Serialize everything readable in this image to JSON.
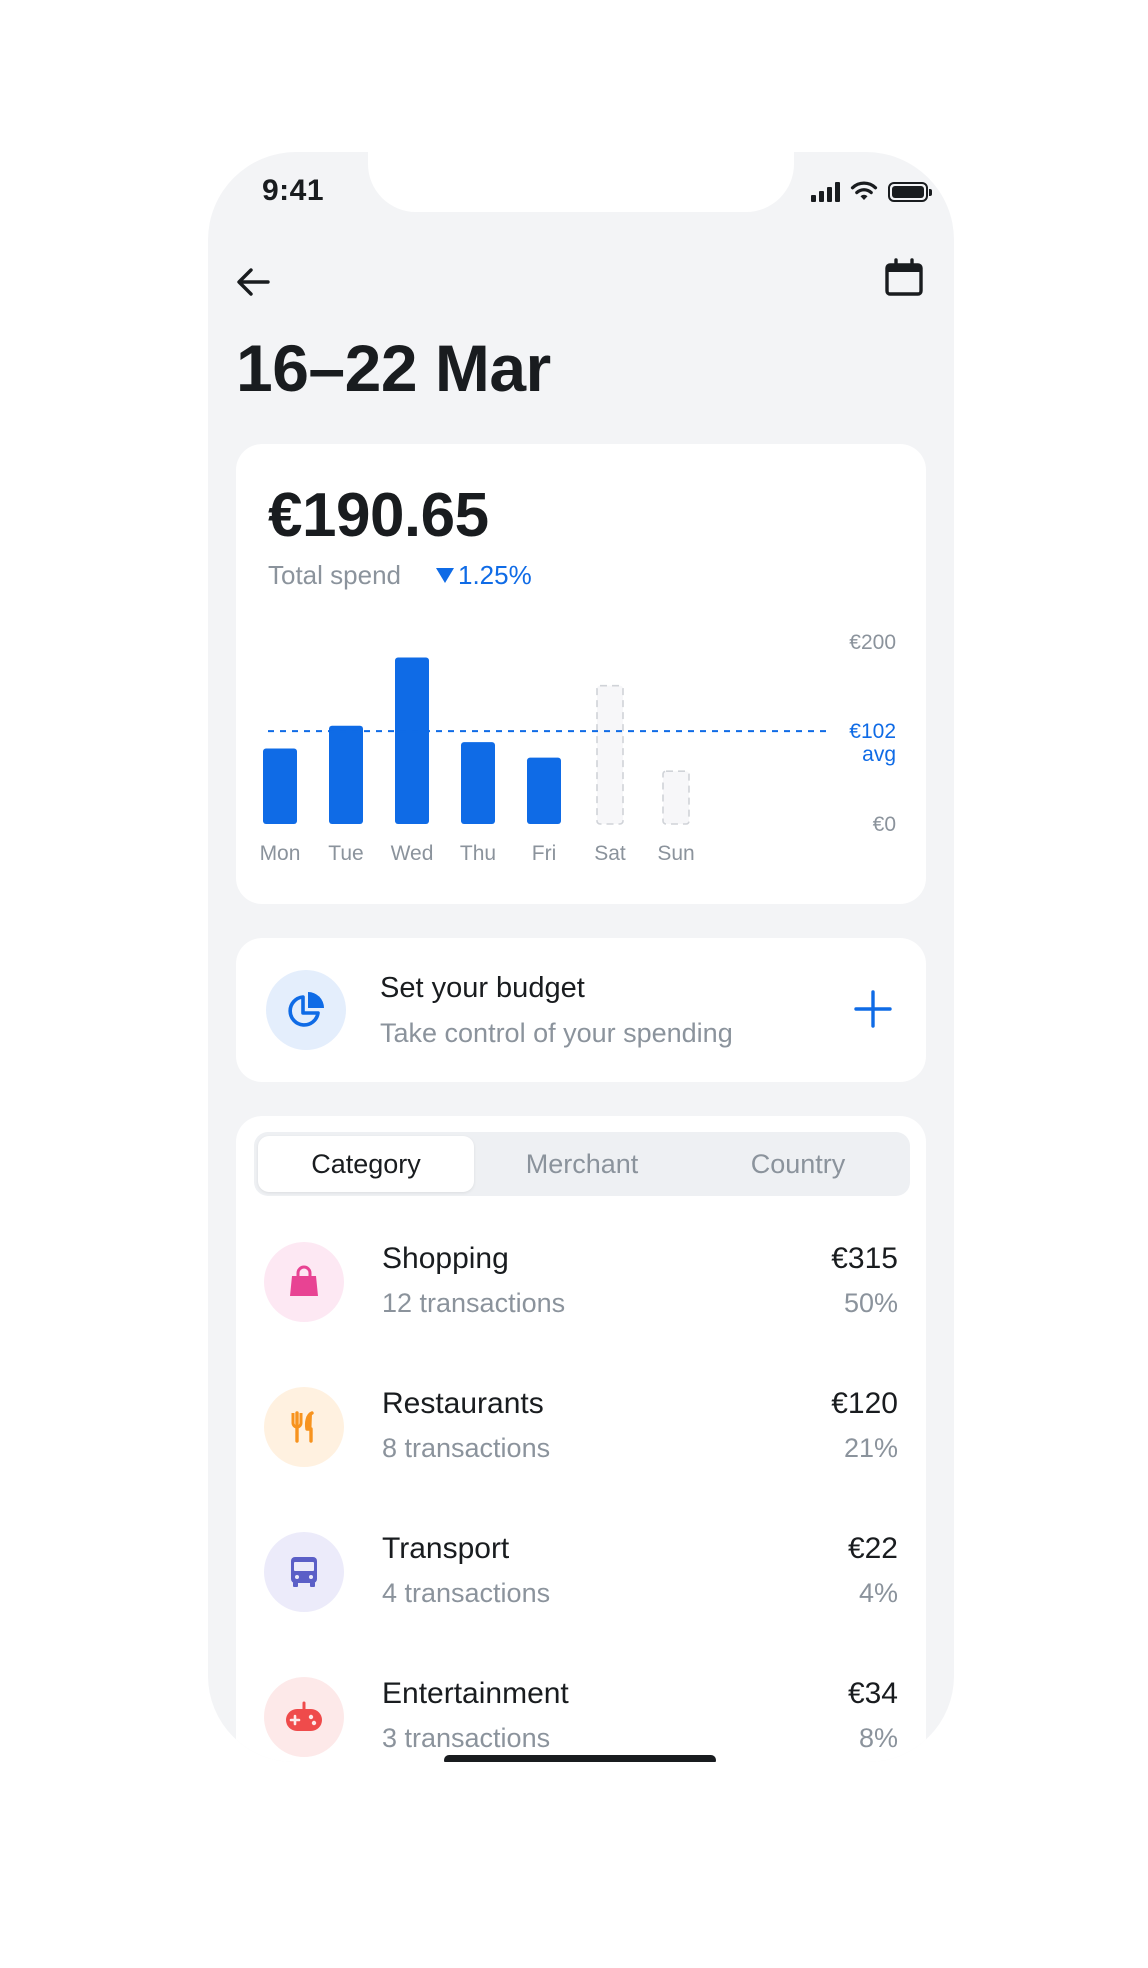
{
  "status_bar": {
    "time": "9:41"
  },
  "header": {
    "title": "16–22 Mar"
  },
  "summary": {
    "amount": "€190.65",
    "label": "Total spend",
    "change": "1.25%",
    "change_direction": "down",
    "accent_color": "#0f6be6"
  },
  "chart_data": {
    "type": "bar",
    "categories": [
      "Mon",
      "Tue",
      "Wed",
      "Thu",
      "Fri",
      "Sat",
      "Sun"
    ],
    "values": [
      83,
      108,
      183,
      90,
      73,
      152,
      58
    ],
    "placeholder_days": [
      "Sat",
      "Sun"
    ],
    "avg_value": 102,
    "avg_label": "€102",
    "avg_sublabel": "avg",
    "ylim": [
      0,
      200
    ],
    "ytick_labels": [
      "€200",
      "€0"
    ],
    "grid": false,
    "bar_color": "#0f6be6"
  },
  "budget": {
    "title": "Set your budget",
    "subtitle": "Take control of your spending",
    "icon": "pie-chart-icon"
  },
  "tabs": [
    {
      "label": "Category",
      "active": true
    },
    {
      "label": "Merchant",
      "active": false
    },
    {
      "label": "Country",
      "active": false
    }
  ],
  "categories": [
    {
      "name": "Shopping",
      "transactions": "12 transactions",
      "amount": "€315",
      "percent": "50%",
      "icon": "shopping-bag-icon",
      "color": "#e84393",
      "bg": "#fde8f3"
    },
    {
      "name": "Restaurants",
      "transactions": "8 transactions",
      "amount": "€120",
      "percent": "21%",
      "icon": "fork-knife-icon",
      "color": "#f7931e",
      "bg": "#fff1e0"
    },
    {
      "name": "Transport",
      "transactions": "4 transactions",
      "amount": "€22",
      "percent": "4%",
      "icon": "bus-icon",
      "color": "#5b5fc7",
      "bg": "#ecebfa"
    },
    {
      "name": "Entertainment",
      "transactions": "3 transactions",
      "amount": "€34",
      "percent": "8%",
      "icon": "gamepad-icon",
      "color": "#ef4b4b",
      "bg": "#fde9e9"
    }
  ]
}
